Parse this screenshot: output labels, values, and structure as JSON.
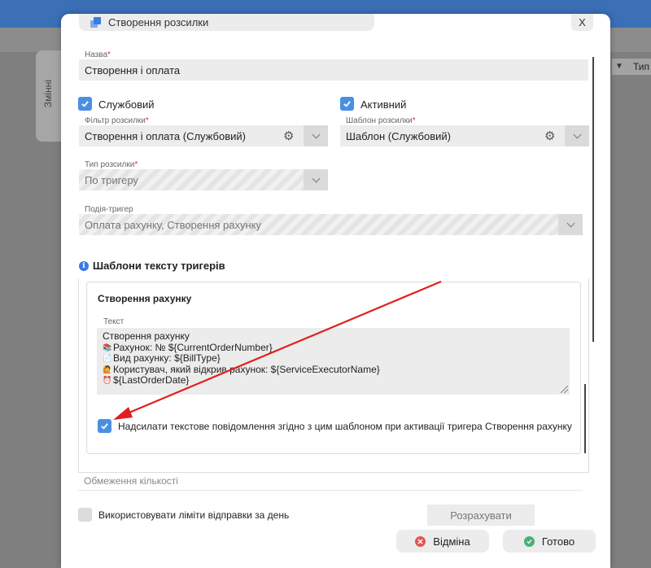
{
  "background": {
    "side_tab_label": "Змінні",
    "column_header": "Тип"
  },
  "dialog": {
    "title": "Створення розсилки",
    "close_label": "X",
    "name": {
      "label": "Назва",
      "value": "Створення і оплата"
    },
    "service_checkbox": {
      "label": "Службовий",
      "checked": true
    },
    "active_checkbox": {
      "label": "Активний",
      "checked": true
    },
    "filter": {
      "label": "Фільтр розсилки",
      "value": "Створення і оплата (Службовий)"
    },
    "template": {
      "label": "Шаблон розсилки",
      "value": "Шаблон (Службовий)"
    },
    "mailing_type": {
      "label": "Тип розсилки",
      "value": "По тригеру"
    },
    "trigger_event": {
      "label": "Подія-тригер",
      "value": "Оплата рахунку, Створення рахунку"
    },
    "templates_section_title": "Шаблони тексту тригерів",
    "card": {
      "title": "Створення рахунку",
      "text_label": "Текст",
      "text_lines": [
        {
          "emoji": "",
          "text": "Створення рахунку"
        },
        {
          "emoji": "📚",
          "text": "Рахунок: № ${CurrentOrderNumber}"
        },
        {
          "emoji": "📄",
          "text": "Вид рахунку:  ${BillType}"
        },
        {
          "emoji": "🙋",
          "text": "Користувач, який відкрив рахунок:  ${ServiceExecutorName}"
        },
        {
          "emoji": "⏰",
          "text": "${LastOrderDate}"
        }
      ],
      "send_checkbox": {
        "label": "Надсилати текстове повідомлення згідно з цим шаблоном при активації тригера Створення рахунку",
        "checked": true
      }
    },
    "quantity_limit_label": "Обмеження кількості",
    "daily_limit_checkbox": {
      "label": "Використовувати ліміти відправки за день",
      "checked": false
    },
    "calculate_button": "Розрахувати",
    "cancel_button": "Відміна",
    "done_button": "Готово"
  },
  "colors": {
    "accent": "#4a90e2",
    "cancel_icon": "#e05555",
    "done_icon": "#4caf7a",
    "annotation_arrow": "#e0201e"
  }
}
